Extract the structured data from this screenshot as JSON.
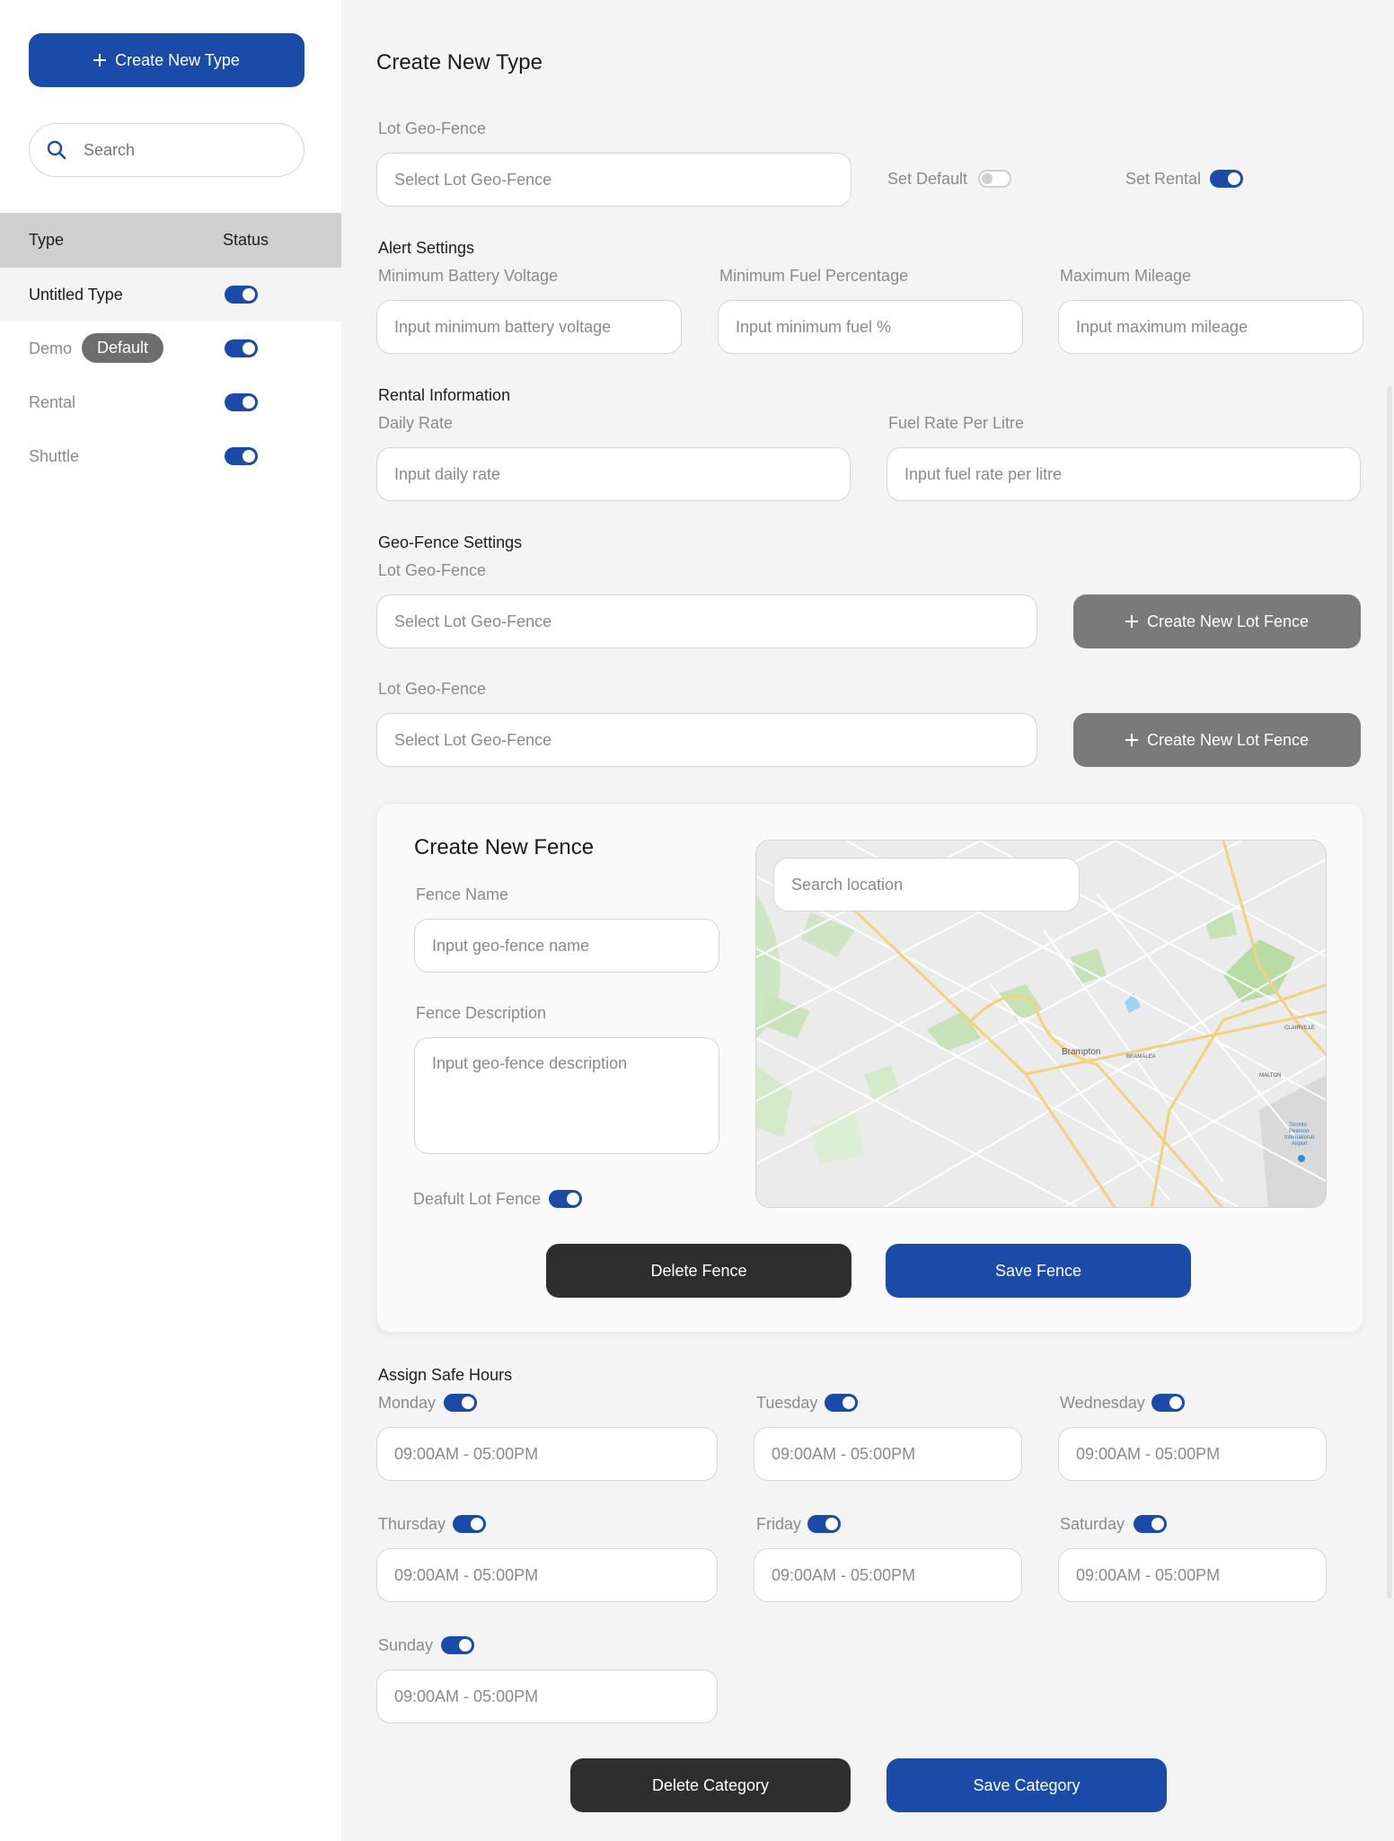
{
  "sidebar": {
    "create_button_label": "Create New Type",
    "search_placeholder": "Search",
    "header_type": "Type",
    "header_status": "Status",
    "items": [
      {
        "label": "Untitled Type",
        "badge": "",
        "status_on": true
      },
      {
        "label": "Demo",
        "badge": "Default",
        "status_on": true
      },
      {
        "label": "Rental",
        "badge": "",
        "status_on": true
      },
      {
        "label": "Shuttle",
        "badge": "",
        "status_on": true
      }
    ]
  },
  "main": {
    "title": "Create New Type",
    "lot_geofence_label": "Lot Geo-Fence",
    "lot_geofence_placeholder": "Select Lot Geo-Fence",
    "set_default_label": "Set Default",
    "set_default_on": false,
    "set_rental_label": "Set Rental",
    "set_rental_on": true,
    "alert": {
      "heading": "Alert Settings",
      "battery_label": "Minimum Battery Voltage",
      "battery_placeholder": "Input minimum battery voltage",
      "fuel_label": "Minimum Fuel Percentage",
      "fuel_placeholder": "Input minimum fuel %",
      "mileage_label": "Maximum Mileage",
      "mileage_placeholder": "Input maximum mileage"
    },
    "rental": {
      "heading": "Rental Information",
      "daily_label": "Daily Rate",
      "daily_placeholder": "Input daily rate",
      "fuel_rate_label": "Fuel Rate Per Litre",
      "fuel_rate_placeholder": "Input fuel rate per litre"
    },
    "geofence": {
      "heading": "Geo-Fence Settings",
      "rows": [
        {
          "label": "Lot Geo-Fence",
          "placeholder": "Select Lot Geo-Fence",
          "button": "Create New Lot Fence"
        },
        {
          "label": "Lot Geo-Fence",
          "placeholder": "Select Lot Geo-Fence",
          "button": "Create New Lot Fence"
        }
      ]
    },
    "fence_card": {
      "title": "Create New Fence",
      "name_label": "Fence Name",
      "name_placeholder": "Input geo-fence name",
      "desc_label": "Fence Description",
      "desc_placeholder": "Input geo-fence description",
      "default_label": "Deafult Lot Fence",
      "default_on": true,
      "map_search_placeholder": "Search location",
      "map_labels": {
        "city": "Brampton",
        "airport": "Toronto Pearson International Airport",
        "district": "BRAMALEA",
        "malton": "MALTON",
        "claireville": "CLAIRVILLE"
      },
      "delete_label": "Delete Fence",
      "save_label": "Save Fence"
    },
    "safe_hours": {
      "heading": "Assign Safe Hours",
      "days": [
        {
          "label": "Monday",
          "on": true,
          "value": "09:00AM - 05:00PM"
        },
        {
          "label": "Tuesday",
          "on": true,
          "value": "09:00AM - 05:00PM"
        },
        {
          "label": "Wednesday",
          "on": true,
          "value": "09:00AM - 05:00PM"
        },
        {
          "label": "Thursday",
          "on": true,
          "value": "09:00AM - 05:00PM"
        },
        {
          "label": "Friday",
          "on": true,
          "value": "09:00AM - 05:00PM"
        },
        {
          "label": "Saturday",
          "on": true,
          "value": "09:00AM - 05:00PM"
        },
        {
          "label": "Sunday",
          "on": true,
          "value": "09:00AM - 05:00PM"
        }
      ]
    },
    "delete_category_label": "Delete Category",
    "save_category_label": "Save Category"
  },
  "colors": {
    "accent": "#1b4ba8",
    "dark": "#2e2e2e",
    "gray_button": "#7a7a7a"
  }
}
